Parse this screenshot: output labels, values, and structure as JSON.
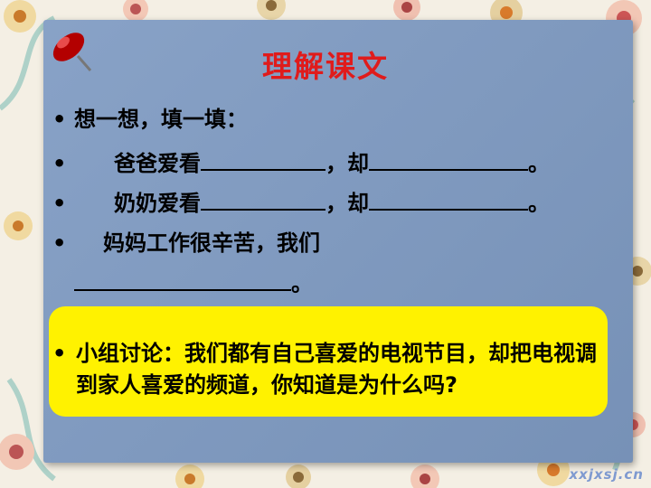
{
  "slide": {
    "title": "理解课文",
    "bullet": "•",
    "lines": [
      {
        "text": "想一想，填一填："
      },
      {
        "prefix": "爸爸爱看",
        "mid": "，却",
        "end": "。"
      },
      {
        "prefix": "奶奶爱看",
        "mid": "，却",
        "end": "。"
      },
      {
        "prefix": "妈妈工作很辛苦，我们",
        "end2": "。"
      }
    ],
    "discussion": "小组讨论：我们都有自己喜爱的电视节目，却把电视调到家人喜爱的频道，你知道是为什么吗?",
    "watermark": "xxjxsj.cn"
  },
  "colors": {
    "card": "#7e9ac2",
    "title": "#e01b1b",
    "highlight": "#fff200"
  }
}
